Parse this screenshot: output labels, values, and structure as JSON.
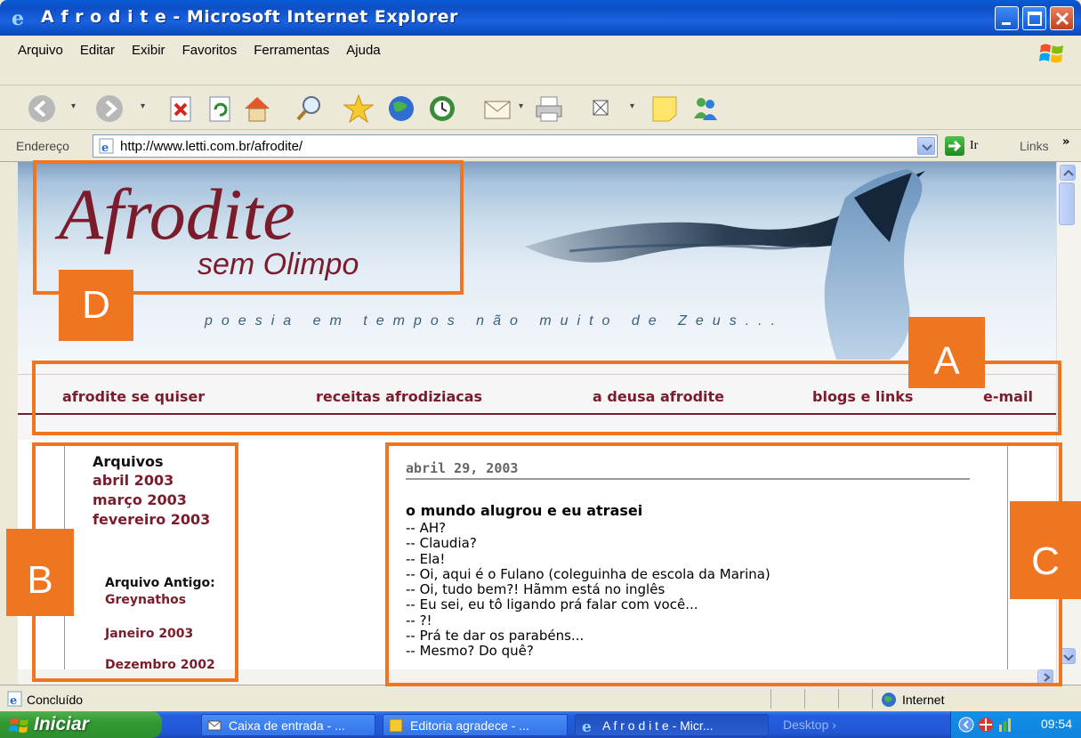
{
  "window": {
    "title": "A f r o d i t e - Microsoft Internet Explorer"
  },
  "menu": {
    "items": [
      "Arquivo",
      "Editar",
      "Exibir",
      "Favoritos",
      "Ferramentas",
      "Ajuda"
    ]
  },
  "address": {
    "label": "Endereço",
    "url": "http://www.letti.com.br/afrodite/",
    "go_label": "Ir",
    "links_label": "Links",
    "chevron": "»"
  },
  "page": {
    "brand": "Afrodite",
    "subbrand": "sem Olimpo",
    "tagline": "poesia em tempos não muito de Zeus...",
    "nav": [
      "afrodite se quiser",
      "receitas afrodiziacas",
      "a deusa afrodite",
      "blogs e links",
      "e-mail"
    ],
    "sidebar": {
      "heading": "Arquivos",
      "archives": [
        "abril 2003",
        "março 2003",
        "fevereiro 2003"
      ],
      "old_heading": "Arquivo Antigo:",
      "old_links": [
        "Greynathos",
        "Janeiro 2003",
        "Dezembro 2002"
      ]
    },
    "post": {
      "date": "abril 29, 2003",
      "title": "o mundo alugrou e eu atrasei",
      "lines": [
        "-- AH?",
        "-- Claudia?",
        "-- Ela!",
        "-- Oi, aqui é o Fulano (coleguinha de escola da Marina)",
        "-- Oi, tudo bem?! Hãmm está no inglês",
        "-- Eu sei, eu tô ligando prá falar com você...",
        "-- ?!",
        "-- Prá te dar os parabéns...",
        "-- Mesmo? Do quê?"
      ]
    }
  },
  "annotations": {
    "a": "A",
    "b": "B",
    "c": "C",
    "d": "D",
    "color": "#f07521"
  },
  "status": {
    "text": "Concluído",
    "zone": "Internet"
  },
  "taskbar": {
    "start": "Iniciar",
    "tasks": [
      "Caixa de entrada - ...",
      "Editoria agradece - ...",
      "A f r o d i t e - Micr...",
      "Desktop"
    ],
    "clock": "09:54"
  },
  "colors": {
    "accent": "#7b1c2c",
    "titlebar": "#0a5bd6",
    "overlay": "#f07521"
  }
}
